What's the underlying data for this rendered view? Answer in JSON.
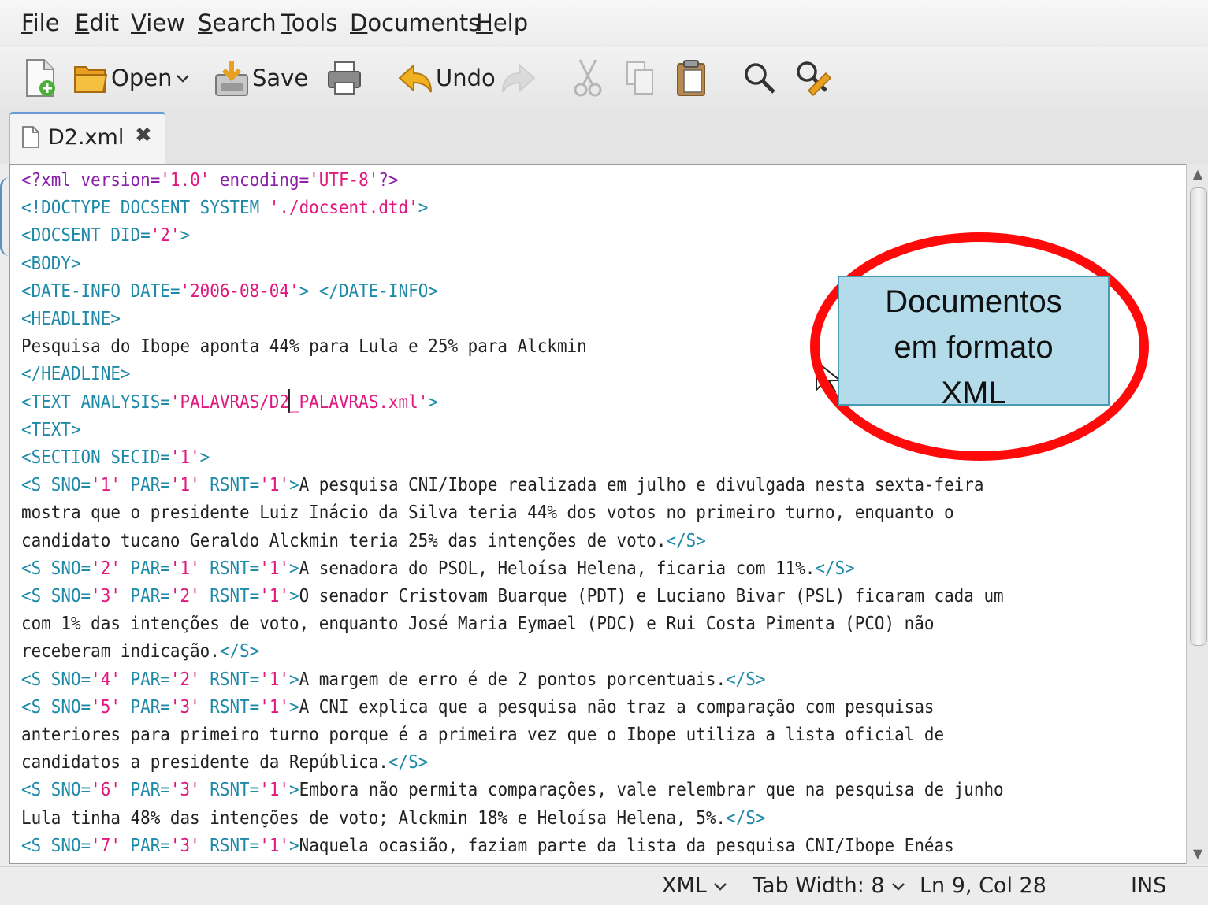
{
  "menu": {
    "items": [
      {
        "first": "F",
        "rest": "ile"
      },
      {
        "first": "E",
        "rest": "dit"
      },
      {
        "first": "V",
        "rest": "iew"
      },
      {
        "first": "S",
        "rest": "earch"
      },
      {
        "first": "T",
        "rest": "ools"
      },
      {
        "first": "D",
        "rest": "ocuments"
      },
      {
        "first": "H",
        "rest": "elp"
      }
    ]
  },
  "toolbar": {
    "open_label": "Open",
    "save_label": "Save",
    "undo_label": "Undo"
  },
  "tab": {
    "label": "D2.xml",
    "close_glyph": "✖"
  },
  "editor": {
    "lines": [
      "<?xml version='1.0' encoding='UTF-8'?>",
      "<!DOCTYPE DOCSENT SYSTEM './docsent.dtd'>",
      "<DOCSENT DID='2'>",
      "<BODY>",
      "<DATE-INFO DATE='2006-08-04'> </DATE-INFO>",
      "<HEADLINE>",
      "Pesquisa do Ibope aponta 44% para Lula e 25% para Alckmin",
      "</HEADLINE>",
      "<TEXT ANALYSIS='PALAVRAS/D2_PALAVRAS.xml'>",
      "<TEXT>",
      "<SECTION SECID='1'>",
      "<S SNO='1' PAR='1' RSNT='1'>A pesquisa CNI/Ibope realizada em julho e divulgada nesta sexta-feira",
      "mostra que o presidente Luiz Inácio da Silva teria 44% dos votos no primeiro turno, enquanto o",
      "candidato tucano Geraldo Alckmin teria 25% das intenções de voto.</S>",
      "<S SNO='2' PAR='1' RSNT='1'>A senadora do PSOL, Heloísa Helena, ficaria com 11%.</S>",
      "<S SNO='3' PAR='2' RSNT='1'>O senador Cristovam Buarque (PDT) e Luciano Bivar (PSL) ficaram cada um",
      "com 1% das intenções de voto, enquanto José Maria Eymael (PDC) e Rui Costa Pimenta (PCO) não",
      "receberam indicação.</S>",
      "<S SNO='4' PAR='2' RSNT='1'>A margem de erro é de 2 pontos porcentuais.</S>",
      "<S SNO='5' PAR='3' RSNT='1'>A CNI explica que a pesquisa não traz a comparação com pesquisas",
      "anteriores para primeiro turno porque é a primeira vez que o Ibope utiliza a lista oficial de",
      "candidatos a presidente da República.</S>",
      "<S SNO='6' PAR='3' RSNT='1'>Embora não permita comparações, vale relembrar que na pesquisa de junho",
      "Lula tinha 48% das intenções de voto; Alckmin 18% e Heloísa Helena, 5%.</S>",
      "<S SNO='7' PAR='3' RSNT='1'>Naquela ocasião, faziam parte da lista da pesquisa CNI/Ibope Enéas"
    ]
  },
  "statusbar": {
    "language": "XML",
    "tab_width": "Tab Width: 8",
    "position": "Ln 9, Col 28",
    "mode": "INS"
  },
  "annotation": {
    "line1": "Documentos",
    "line2": "em formato",
    "line3": "XML"
  },
  "colors": {
    "tag": "#1f8aa8",
    "string": "#e0187e",
    "processing_instruction": "#8a1fa8",
    "ellipse": "#ff0a0a",
    "callout_fill": "#b3dbe9"
  }
}
